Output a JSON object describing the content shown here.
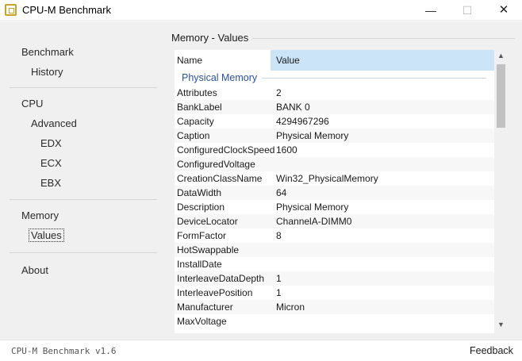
{
  "window": {
    "title": "CPU-M Benchmark",
    "minimize_glyph": "—",
    "maximize_glyph": "☐",
    "close_glyph": "✕"
  },
  "sidebar": {
    "benchmark": "Benchmark",
    "history": "History",
    "cpu": "CPU",
    "advanced": "Advanced",
    "edx": "EDX",
    "ecx": "ECX",
    "ebx": "EBX",
    "memory": "Memory",
    "values": "Values",
    "about": "About"
  },
  "main": {
    "section_title": "Memory - Values",
    "grid": {
      "header_name": "Name",
      "header_value": "Value",
      "group": "Physical Memory",
      "rows": [
        {
          "name": "Attributes",
          "value": "2"
        },
        {
          "name": "BankLabel",
          "value": "BANK 0"
        },
        {
          "name": "Capacity",
          "value": "4294967296"
        },
        {
          "name": "Caption",
          "value": "Physical Memory"
        },
        {
          "name": "ConfiguredClockSpeed",
          "value": "1600"
        },
        {
          "name": "ConfiguredVoltage",
          "value": ""
        },
        {
          "name": "CreationClassName",
          "value": "Win32_PhysicalMemory"
        },
        {
          "name": "DataWidth",
          "value": "64"
        },
        {
          "name": "Description",
          "value": "Physical Memory"
        },
        {
          "name": "DeviceLocator",
          "value": "ChannelA-DIMM0"
        },
        {
          "name": "FormFactor",
          "value": "8"
        },
        {
          "name": "HotSwappable",
          "value": ""
        },
        {
          "name": "InstallDate",
          "value": ""
        },
        {
          "name": "InterleaveDataDepth",
          "value": "1"
        },
        {
          "name": "InterleavePosition",
          "value": "1"
        },
        {
          "name": "Manufacturer",
          "value": "Micron"
        },
        {
          "name": "MaxVoltage",
          "value": ""
        }
      ]
    },
    "scroll": {
      "up_glyph": "▲",
      "down_glyph": "▼"
    }
  },
  "footer": {
    "version": "CPU-M Benchmark v1.6",
    "feedback": "Feedback"
  }
}
